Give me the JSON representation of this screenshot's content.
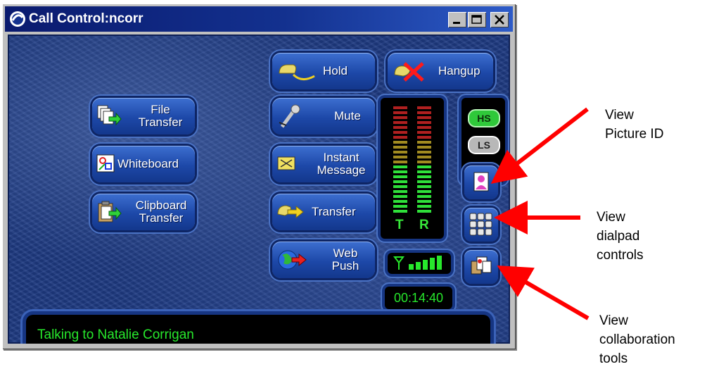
{
  "window": {
    "title": "Call Control:ncorr"
  },
  "buttons": {
    "hold": "Hold",
    "hangup": "Hangup",
    "file_transfer": [
      "File",
      "Transfer"
    ],
    "mute": "Mute",
    "whiteboard": "Whiteboard",
    "instant_message": [
      "Instant",
      "Message"
    ],
    "clipboard_transfer": [
      "Clipboard",
      "Transfer"
    ],
    "transfer": "Transfer",
    "web_push": [
      "Web",
      "Push"
    ]
  },
  "meter": {
    "left_label": "T",
    "right_label": "R"
  },
  "mode": {
    "hs": "HS",
    "ls": "LS"
  },
  "timer": "00:14:40",
  "status": "Talking to Natalie Corrigan",
  "annotations": {
    "picture_id": [
      "View",
      "Picture ID"
    ],
    "dialpad": [
      "View",
      "dialpad",
      "controls"
    ],
    "collaboration": [
      "View",
      "collaboration",
      "tools"
    ]
  },
  "colors": {
    "accent_green": "#27e82c",
    "arrow_red": "#ff0000",
    "panel_blue": "#1e3a82"
  }
}
